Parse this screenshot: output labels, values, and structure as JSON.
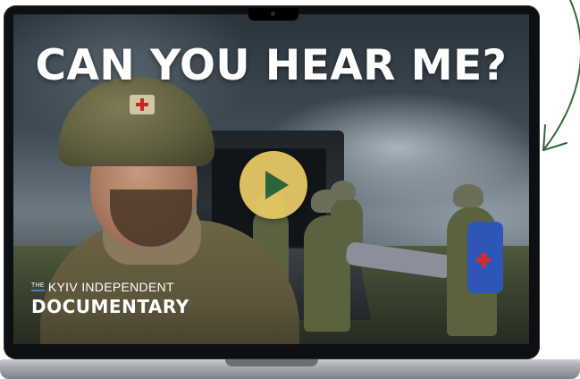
{
  "video": {
    "title": "CAN YOU HEAR ME?",
    "play_icon": "play-icon",
    "brand": {
      "prefix": "THE",
      "name": "KYIV INDEPENDENT",
      "label": "DOCUMENTARY"
    }
  },
  "colors": {
    "play_button": "#e6c864",
    "play_triangle": "#2e6a3a",
    "arrow": "#2e6a3a",
    "brand_underline": "#4a7bd0"
  },
  "decor": {
    "arrow_icon": "hand-drawn-arrow-icon"
  }
}
